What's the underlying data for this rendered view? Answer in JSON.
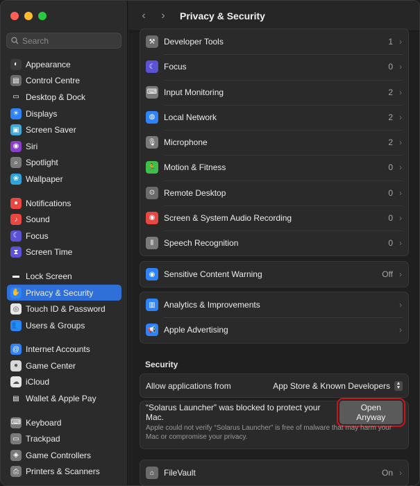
{
  "window": {
    "title": "Privacy & Security"
  },
  "colors": {
    "traffic_close": "#fe5f57",
    "traffic_min": "#febc2e",
    "traffic_max": "#28c840",
    "accent": "#2f6fd8",
    "highlight_outline": "#d0131b"
  },
  "sidebar": {
    "search_placeholder": "Search",
    "groups": [
      [
        {
          "label": "Appearance",
          "icon": "appearance-icon",
          "color": "#3b3b3b",
          "glyph": "◐"
        },
        {
          "label": "Control Centre",
          "icon": "control-centre-icon",
          "color": "#6b6b6b",
          "glyph": "▤"
        },
        {
          "label": "Desktop & Dock",
          "icon": "desktop-dock-icon",
          "color": "#2b2b2b",
          "glyph": "▭"
        },
        {
          "label": "Displays",
          "icon": "displays-icon",
          "color": "#2d83f7",
          "glyph": "☀"
        },
        {
          "label": "Screen Saver",
          "icon": "screen-saver-icon",
          "color": "#3fa8d8",
          "glyph": "▣"
        },
        {
          "label": "Siri",
          "icon": "siri-icon",
          "color": "#8a3fc9",
          "glyph": "◉"
        },
        {
          "label": "Spotlight",
          "icon": "spotlight-icon",
          "color": "#7a7a7a",
          "glyph": "⌕"
        },
        {
          "label": "Wallpaper",
          "icon": "wallpaper-icon",
          "color": "#2fa2d8",
          "glyph": "❀"
        }
      ],
      [
        {
          "label": "Notifications",
          "icon": "notifications-icon",
          "color": "#e9473f",
          "glyph": "●"
        },
        {
          "label": "Sound",
          "icon": "sound-icon",
          "color": "#e9473f",
          "glyph": "♪"
        },
        {
          "label": "Focus",
          "icon": "focus-icon",
          "color": "#5b52d6",
          "glyph": "☾"
        },
        {
          "label": "Screen Time",
          "icon": "screen-time-icon",
          "color": "#5b52d6",
          "glyph": "⧗"
        }
      ],
      [
        {
          "label": "Lock Screen",
          "icon": "lock-screen-icon",
          "color": "#2b2b2b",
          "glyph": "▬"
        },
        {
          "label": "Privacy & Security",
          "icon": "privacy-hand-icon",
          "color": "#2d83f7",
          "glyph": "✋",
          "active": true
        },
        {
          "label": "Touch ID & Password",
          "icon": "touch-id-icon",
          "color": "#e6e6e6",
          "glyph": "◎"
        },
        {
          "label": "Users & Groups",
          "icon": "users-groups-icon",
          "color": "#2d83f7",
          "glyph": "👥"
        }
      ],
      [
        {
          "label": "Internet Accounts",
          "icon": "internet-accounts-icon",
          "color": "#2d83f7",
          "glyph": "@"
        },
        {
          "label": "Game Center",
          "icon": "game-center-icon",
          "color": "#d8d8d8",
          "glyph": "●"
        },
        {
          "label": "iCloud",
          "icon": "icloud-icon",
          "color": "#e6e6e6",
          "glyph": "☁"
        },
        {
          "label": "Wallet & Apple Pay",
          "icon": "wallet-icon",
          "color": "#2b2b2b",
          "glyph": "▤"
        }
      ],
      [
        {
          "label": "Keyboard",
          "icon": "keyboard-icon",
          "color": "#7a7a7a",
          "glyph": "⌨"
        },
        {
          "label": "Trackpad",
          "icon": "trackpad-icon",
          "color": "#7a7a7a",
          "glyph": "▭"
        },
        {
          "label": "Game Controllers",
          "icon": "game-controllers-icon",
          "color": "#7a7a7a",
          "glyph": "◈"
        },
        {
          "label": "Printers & Scanners",
          "icon": "printers-scanners-icon",
          "color": "#7a7a7a",
          "glyph": "⎙"
        }
      ]
    ]
  },
  "main": {
    "permissions": [
      {
        "label": "Developer Tools",
        "value": "1",
        "icon": "developer-tools-icon",
        "color": "#6b6b6b",
        "glyph": "⚒"
      },
      {
        "label": "Focus",
        "value": "0",
        "icon": "focus-moon-icon",
        "color": "#5b52d6",
        "glyph": "☾"
      },
      {
        "label": "Input Monitoring",
        "value": "2",
        "icon": "keyboard-icon",
        "color": "#7a7a7a",
        "glyph": "⌨"
      },
      {
        "label": "Local Network",
        "value": "2",
        "icon": "globe-icon",
        "color": "#2d83f7",
        "glyph": "◍"
      },
      {
        "label": "Microphone",
        "value": "2",
        "icon": "microphone-icon",
        "color": "#7a7a7a",
        "glyph": "🎙"
      },
      {
        "label": "Motion & Fitness",
        "value": "0",
        "icon": "running-icon",
        "color": "#3fbf4a",
        "glyph": "🏃"
      },
      {
        "label": "Remote Desktop",
        "value": "0",
        "icon": "binoculars-icon",
        "color": "#6b6b6b",
        "glyph": "⊙"
      },
      {
        "label": "Screen & System Audio Recording",
        "value": "0",
        "icon": "record-icon",
        "color": "#e9473f",
        "glyph": "◉"
      },
      {
        "label": "Speech Recognition",
        "value": "0",
        "icon": "waveform-icon",
        "color": "#7a7a7a",
        "glyph": "⦀"
      }
    ],
    "sensitive": {
      "label": "Sensitive Content Warning",
      "value": "Off",
      "icon": "eye-warning-icon",
      "color": "#2d83f7",
      "glyph": "◉"
    },
    "analytics": [
      {
        "label": "Analytics & Improvements",
        "icon": "analytics-chart-icon",
        "color": "#2d83f7",
        "glyph": "▥"
      },
      {
        "label": "Apple Advertising",
        "icon": "megaphone-icon",
        "color": "#2d83f7",
        "glyph": "📢"
      }
    ],
    "security": {
      "title": "Security",
      "allow_label": "Allow applications from",
      "allow_value": "App Store & Known Developers",
      "blocked_message": "“Solarus Launcher” was blocked to protect your Mac.",
      "open_anyway": "Open Anyway",
      "note": "Apple could not verify “Solarus Launcher” is free of malware that may harm your Mac or compromise your privacy."
    },
    "filevault": {
      "label": "FileVault",
      "value": "On",
      "icon": "filevault-icon",
      "color": "#6b6b6b",
      "glyph": "⌂"
    }
  }
}
